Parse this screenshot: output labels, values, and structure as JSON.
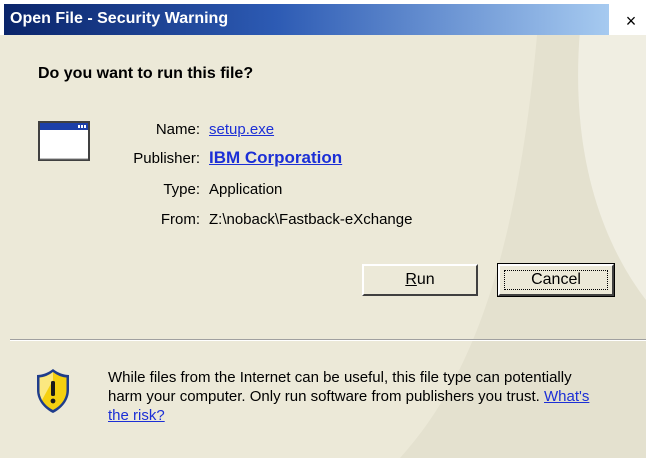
{
  "window": {
    "title": "Open File - Security Warning",
    "close_label": "×"
  },
  "prompt": "Do you want to run this file?",
  "file_info": {
    "name_label": "Name:",
    "name_value": "setup.exe",
    "publisher_label": "Publisher:",
    "publisher_value": "IBM Corporation",
    "type_label": "Type:",
    "type_value": "Application",
    "from_label": "From:",
    "from_value": "Z:\\noback\\Fastback-eXchange"
  },
  "buttons": {
    "run_mnemonic": "R",
    "run_rest": "un",
    "cancel_label": "Cancel"
  },
  "warning": {
    "text": "While files from the Internet can be useful, this file type can potentially harm your computer. Only run software from publishers you trust.",
    "link": "What's the risk?"
  },
  "icons": {
    "file": "application-window-icon",
    "warning": "security-shield-warning-icon"
  },
  "colors": {
    "title_gradient_start": "#0a246a",
    "title_gradient_end": "#a6caf0",
    "dialog_background": "#ece9d8",
    "link": "#1c2fd6",
    "shield_yellow": "#f5d010"
  }
}
